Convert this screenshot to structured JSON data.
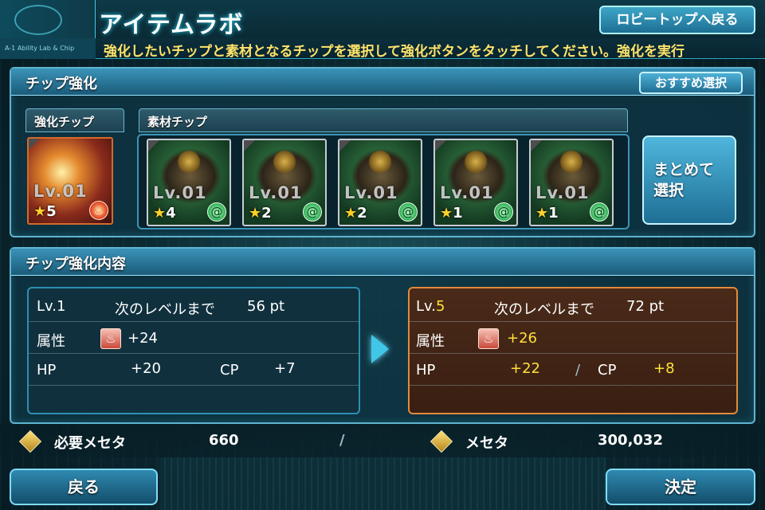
{
  "header": {
    "title": "アイテムラボ",
    "lobby_button": "ロビートップへ戻る",
    "ticker_left": "A-1 Ability Lab & Chip",
    "ticker": "強化したいチップと素材となるチップを選択して強化ボタンをタッチしてください。強化を実行"
  },
  "enhance_panel": {
    "title": "チップ強化",
    "recommend_button": "おすすめ選択",
    "base_label": "強化チップ",
    "material_label": "素材チップ",
    "bulk_button_line1": "まとめて",
    "bulk_button_line2": "選択",
    "base_chip": {
      "level": "Lv.01",
      "star_count": "5",
      "element": "fire-icon"
    },
    "material_chips": [
      {
        "level": "Lv.01",
        "star_count": "4",
        "element": "wind-icon"
      },
      {
        "level": "Lv.01",
        "star_count": "2",
        "element": "wind-icon"
      },
      {
        "level": "Lv.01",
        "star_count": "2",
        "element": "wind-icon"
      },
      {
        "level": "Lv.01",
        "star_count": "1",
        "element": "wind-icon"
      },
      {
        "level": "Lv.01",
        "star_count": "1",
        "element": "wind-icon"
      }
    ]
  },
  "details_panel": {
    "title": "チップ強化内容",
    "current": {
      "level": "Lv.1",
      "next_label": "次のレベルまで",
      "next_pt": "56 pt",
      "attr_label": "属性",
      "attr_value": "+24",
      "hp_label": "HP",
      "hp_value": "+20",
      "cp_label": "CP",
      "cp_value": "+7"
    },
    "after": {
      "level_prefix": "Lv.",
      "level_num": "5",
      "next_label": "次のレベルまで",
      "next_pt": "72 pt",
      "attr_label": "属性",
      "attr_value": "+26",
      "hp_label": "HP",
      "hp_value": "+22",
      "separator": "/",
      "cp_label": "CP",
      "cp_value": "+8"
    }
  },
  "cost": {
    "required_label": "必要メセタ",
    "required_value": "660",
    "separator": "/",
    "meseta_label": "メセタ",
    "meseta_value": "300,032"
  },
  "footer": {
    "back_button": "戻る",
    "confirm_button": "決定"
  },
  "colors": {
    "accent": "#41c6e8",
    "highlight_yellow": "#ffe23a",
    "after_panel_border": "#e38a3a"
  }
}
